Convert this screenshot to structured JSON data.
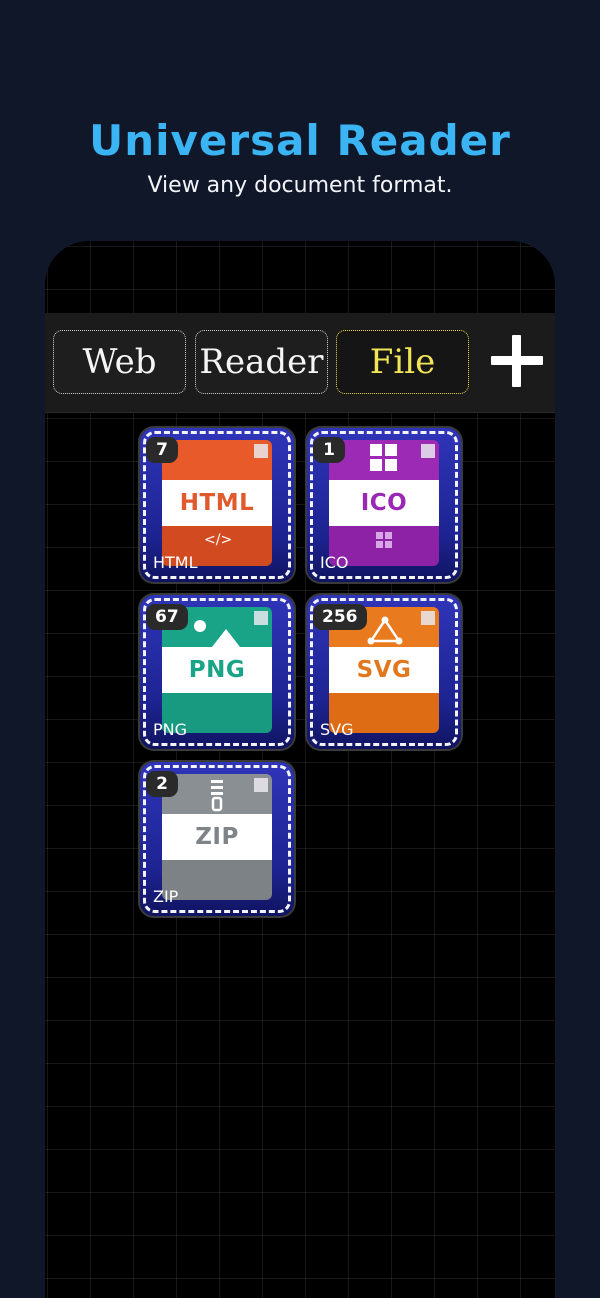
{
  "hero": {
    "title": "Universal Reader",
    "subtitle": "View any document format."
  },
  "toolbar": {
    "tabs": [
      {
        "label": "Web",
        "active": false
      },
      {
        "label": "Reader",
        "active": false
      },
      {
        "label": "File",
        "active": true
      }
    ],
    "add_icon": "plus-icon"
  },
  "files": [
    {
      "type": "HTML",
      "count": "7",
      "label": "HTML",
      "top_color": "#e85a2a",
      "bottom_color": "#d24a1f",
      "text_color": "#e05a2e",
      "icon": "code-icon",
      "icon_glyph": "</>"
    },
    {
      "type": "ICO",
      "count": "1",
      "label": "ICO",
      "top_color": "#9c2ab4",
      "bottom_color": "#8d22a6",
      "text_color": "#9a28b4",
      "icon": "grid-icon",
      "icon_glyph": ""
    },
    {
      "type": "PNG",
      "count": "67",
      "label": "PNG",
      "top_color": "#1aa487",
      "bottom_color": "#189a80",
      "text_color": "#1aa487",
      "icon": "image-icon",
      "icon_glyph": ""
    },
    {
      "type": "SVG",
      "count": "256",
      "label": "SVG",
      "top_color": "#ea7a1e",
      "bottom_color": "#de6c14",
      "text_color": "#e2781e",
      "icon": "vector-icon",
      "icon_glyph": ""
    },
    {
      "type": "ZIP",
      "count": "2",
      "label": "ZIP",
      "top_color": "#8a8f94",
      "bottom_color": "#7d8287",
      "text_color": "#7f8489",
      "icon": "zipper-icon",
      "icon_glyph": ""
    }
  ]
}
